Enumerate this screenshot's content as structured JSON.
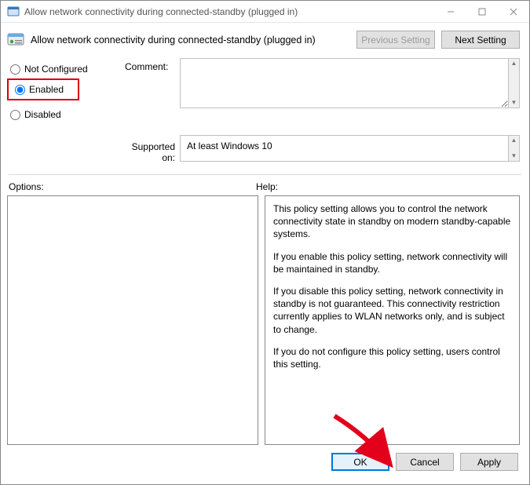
{
  "window": {
    "title": "Allow network connectivity during connected-standby (plugged in)"
  },
  "header": {
    "heading": "Allow network connectivity during connected-standby (plugged in)",
    "prev_label": "Previous Setting",
    "next_label": "Next Setting"
  },
  "state": {
    "radios": {
      "not_configured": "Not Configured",
      "enabled": "Enabled",
      "disabled": "Disabled",
      "selected": "enabled"
    },
    "comment_label": "Comment:",
    "comment_value": "",
    "supported_label": "Supported on:",
    "supported_value": "At least Windows 10"
  },
  "panes": {
    "options_label": "Options:",
    "help_label": "Help:",
    "help_paragraphs": {
      "p1": "This policy setting allows you to control the network connectivity state in standby on modern standby-capable systems.",
      "p2": "If you enable this policy setting, network connectivity will be maintained in standby.",
      "p3": "If you disable this policy setting, network connectivity in standby is not guaranteed. This connectivity restriction currently applies to WLAN networks only, and is subject to change.",
      "p4": "If you do not configure this policy setting, users control this setting."
    }
  },
  "footer": {
    "ok": "OK",
    "cancel": "Cancel",
    "apply": "Apply"
  }
}
